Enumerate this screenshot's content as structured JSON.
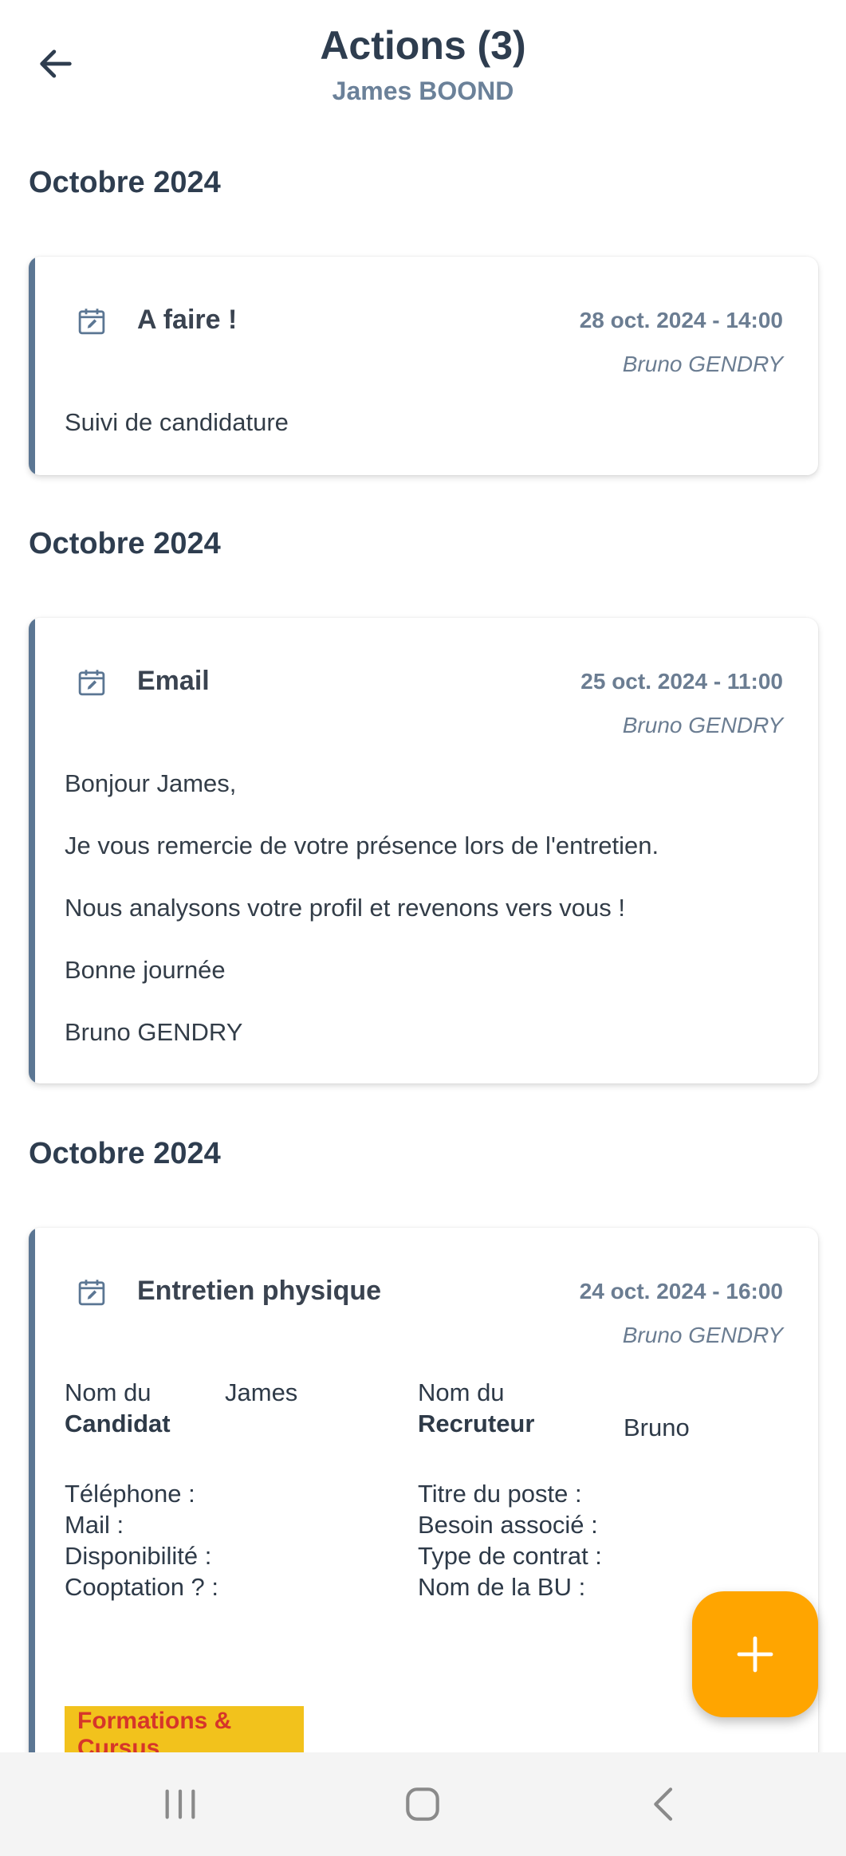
{
  "header": {
    "title": "Actions (3)",
    "subtitle": "James BOOND",
    "back_icon": "arrow-left-icon"
  },
  "sections": [
    {
      "month": "Octobre 2024",
      "card": {
        "icon": "calendar-edit-icon",
        "type": "A faire !",
        "date": "28 oct. 2024 - 14:00",
        "author": "Bruno GENDRY",
        "lines": [
          "Suivi de candidature"
        ]
      }
    },
    {
      "month": "Octobre 2024",
      "card": {
        "icon": "calendar-edit-icon",
        "type": "Email",
        "date": "25 oct. 2024 - 11:00",
        "author": "Bruno GENDRY",
        "lines": [
          "Bonjour James,",
          "Je vous remercie de votre présence lors de l'entretien.",
          "Nous analysons votre profil et revenons vers vous !",
          "Bonne journée",
          "Bruno GENDRY"
        ]
      }
    },
    {
      "month": "Octobre 2024",
      "card": {
        "icon": "calendar-edit-icon",
        "type": "Entretien physique",
        "date": "24 oct. 2024 - 16:00",
        "author": "Bruno GENDRY",
        "candidate_label_1": "Nom du",
        "candidate_label_2": "Candidat",
        "candidate_value": "James",
        "recruiter_label_1": "Nom du",
        "recruiter_label_2": "Recruteur",
        "recruiter_value": "Bruno",
        "left_fields": [
          "Téléphone :",
          "Mail :",
          "Disponibilité :",
          "Cooptation ? :"
        ],
        "right_fields": [
          "Titre du poste :",
          "Besoin associé  :",
          "Type de contrat :",
          "Nom de la BU :"
        ],
        "highlight": "Formations & Cursus"
      }
    }
  ],
  "colors": {
    "accent_bar": "#5b7693",
    "fab": "#ffa500",
    "highlight_bg": "#f2c21c",
    "highlight_text": "#d6352a"
  },
  "fab": {
    "icon": "plus-icon"
  },
  "navbar": {
    "recents_icon": "recent-apps-icon",
    "home_icon": "home-icon",
    "back_icon": "nav-back-icon"
  }
}
